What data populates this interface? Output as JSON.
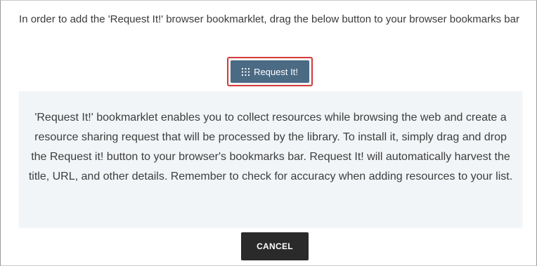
{
  "dialog": {
    "instruction": "In order to add the 'Request It!' browser bookmarklet, drag the below button to your browser bookmarks bar",
    "bookmarklet_button": {
      "label": "Request It!",
      "icon": "drag-handle-icon",
      "color": "#4b6a84",
      "highlight_color": "#d63a3a"
    },
    "info_text": "'Request It!' bookmarklet enables you to collect resources while browsing the web and create a resource sharing request that will be processed by the library. To install it, simply drag and drop the Request it! button to your browser's bookmarks bar. Request It! will automatically harvest the title, URL, and other details. Remember to check for accuracy when adding resources to your list.",
    "cancel_label": "CANCEL"
  }
}
